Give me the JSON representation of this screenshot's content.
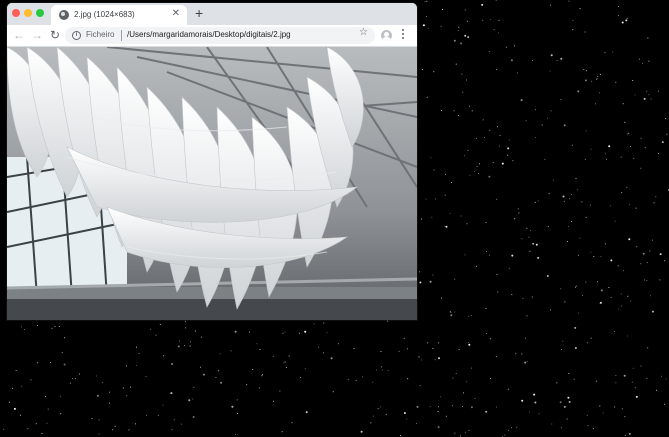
{
  "browser": {
    "tab": {
      "title": "2.jpg (1024×683)",
      "favicon": "globe-icon"
    },
    "new_tab_label": "+",
    "toolbar": {
      "back_icon": "arrow-left-icon",
      "forward_icon": "arrow-right-icon",
      "reload_icon": "reload-icon",
      "address": {
        "security_label": "Ficheiro",
        "url": "/Users/margaridamorais/Desktop/digitais/2.jpg"
      },
      "bookmark_icon": "star-icon",
      "profile_icon": "avatar-icon",
      "menu_icon": "kebab-menu-icon"
    }
  },
  "content": {
    "image_alt": "2.jpg"
  },
  "colors": {
    "tabbar": "#dee1e6",
    "omnibox": "#f1f3f4",
    "desktop": "#000000"
  }
}
